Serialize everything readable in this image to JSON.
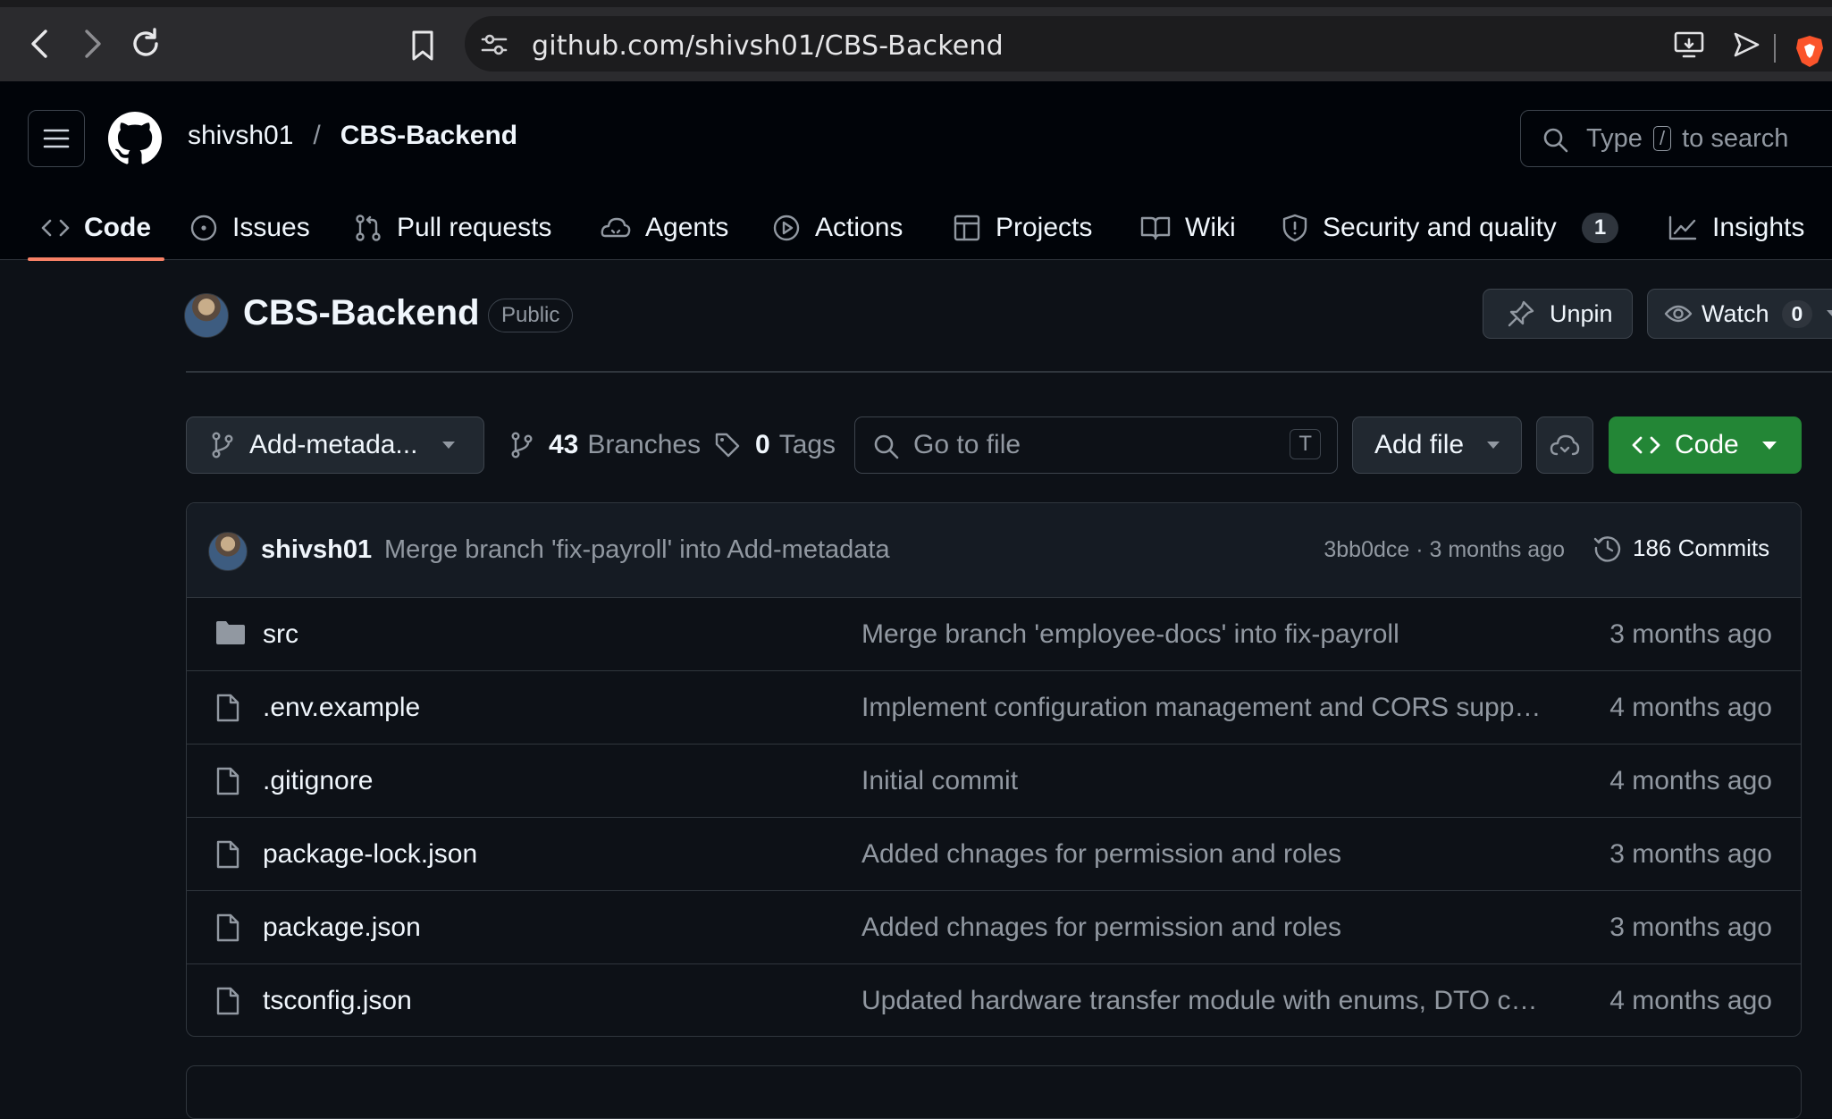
{
  "browser": {
    "url": "github.com/shivsh01/CBS-Backend"
  },
  "header": {
    "owner": "shivsh01",
    "separator": "/",
    "repo": "CBS-Backend",
    "search_prefix": "Type",
    "search_key": "/",
    "search_suffix": "to search"
  },
  "tabs": [
    {
      "label": "Code",
      "icon": "code-icon",
      "active": true
    },
    {
      "label": "Issues",
      "icon": "issue-opened-icon"
    },
    {
      "label": "Pull requests",
      "icon": "git-pull-request-icon"
    },
    {
      "label": "Agents",
      "icon": "agent-icon"
    },
    {
      "label": "Actions",
      "icon": "play-icon"
    },
    {
      "label": "Projects",
      "icon": "table-icon"
    },
    {
      "label": "Wiki",
      "icon": "book-icon"
    },
    {
      "label": "Security and quality",
      "icon": "shield-icon",
      "count": "1"
    },
    {
      "label": "Insights",
      "icon": "graph-icon"
    }
  ],
  "repo": {
    "name": "CBS-Backend",
    "visibility": "Public",
    "unpin_label": "Unpin",
    "watch_label": "Watch",
    "watch_count": "0"
  },
  "toolbar": {
    "branch": "Add-metada...",
    "branches_count": "43",
    "branches_label": "Branches",
    "tags_count": "0",
    "tags_label": "Tags",
    "goto_placeholder": "Go to file",
    "goto_key": "T",
    "add_file_label": "Add file",
    "code_label": "Code"
  },
  "latest_commit": {
    "author": "shivsh01",
    "message": "Merge branch 'fix-payroll' into Add-metadata",
    "sha_time": "3bb0dce · 3 months ago",
    "commits_label": "186 Commits"
  },
  "files": [
    {
      "name": "src",
      "type": "folder",
      "message": "Merge branch 'employee-docs' into fix-payroll",
      "time": "3 months ago"
    },
    {
      "name": ".env.example",
      "type": "file",
      "message": "Implement configuration management and CORS suppor...",
      "time": "4 months ago"
    },
    {
      "name": ".gitignore",
      "type": "file",
      "message": "Initial commit",
      "time": "4 months ago"
    },
    {
      "name": "package-lock.json",
      "type": "file",
      "message": "Added chnages for permission and roles",
      "time": "3 months ago"
    },
    {
      "name": "package.json",
      "type": "file",
      "message": "Added chnages for permission and roles",
      "time": "3 months ago"
    },
    {
      "name": "tsconfig.json",
      "type": "file",
      "message": "Updated hardware transfer module with enums, DTO cha...",
      "time": "4 months ago"
    }
  ],
  "colors": {
    "accent_green": "#238636",
    "tab_underline": "#f78166",
    "background": "#0d1117"
  }
}
